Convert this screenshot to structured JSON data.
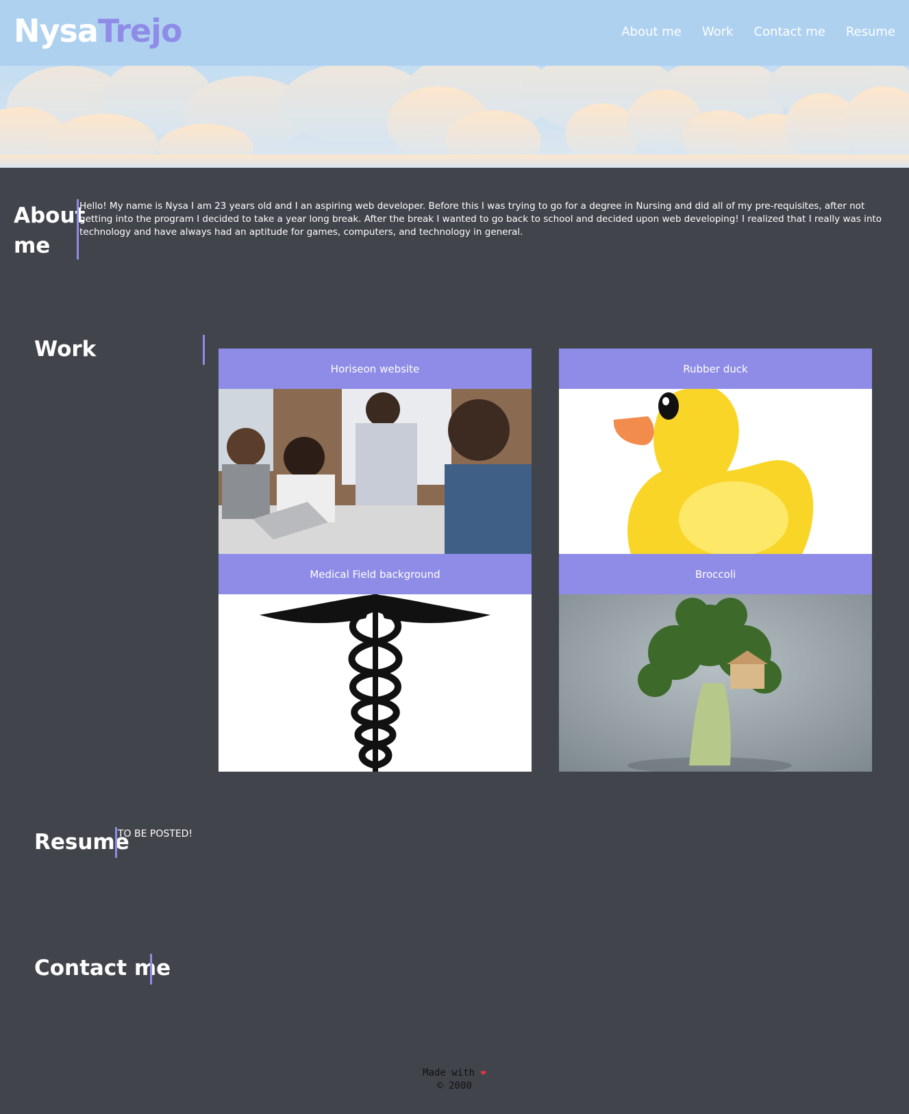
{
  "header": {
    "logo_first": "Nysa",
    "logo_last": "Trejo",
    "nav": [
      "About me",
      "Work",
      "Contact me",
      "Resume"
    ]
  },
  "about": {
    "title_line1": "About",
    "title_line2": "me",
    "text": "Hello! My name is Nysa I am 23 years old and I an aspiring web developer. Before this I was trying to go for a degree in Nursing and did all of my pre-requisites, after not getting into the program I decided to take a year long break. After the break I wanted to go back to school and decided upon web developing! I realized that I really was into technology and have always had an aptitude for games, computers, and technology in general."
  },
  "work": {
    "title": "Work",
    "projects": [
      {
        "label": "Horiseon website",
        "image": "team-meeting-photo"
      },
      {
        "label": "Rubber duck",
        "image": "rubber-duck-illustration"
      },
      {
        "label": "Medical Field background",
        "image": "caduceus-symbol"
      },
      {
        "label": "Broccoli",
        "image": "broccoli-treehouse-photo"
      }
    ]
  },
  "resume": {
    "title": "Resume",
    "text": "TO BE POSTED!"
  },
  "contact": {
    "title": "Contact me"
  },
  "footer": {
    "made_with": "Made with",
    "heart_icon": "heart-icon",
    "copyright": "© 2000"
  },
  "colors": {
    "header_bg": "#aed1f0",
    "accent": "#8f8ce7",
    "page_bg": "#41444b"
  }
}
